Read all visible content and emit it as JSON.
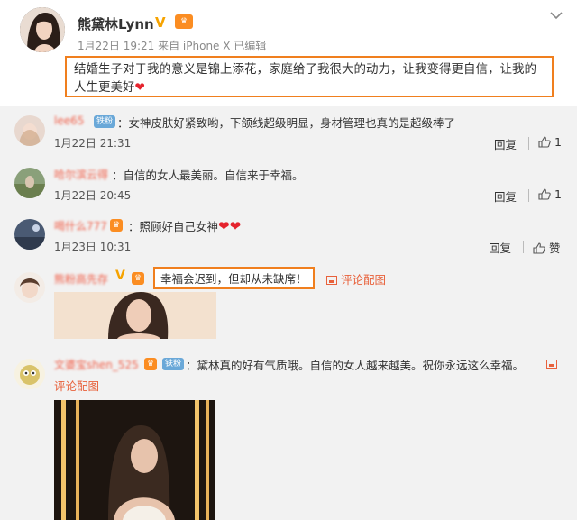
{
  "post": {
    "author": "熊黛林Lynn",
    "verified_badge": "V",
    "meta": "1月22日 19:21 来自 iPhone X   已编辑",
    "text": "结婚生子对于我的意义是锦上添花，家庭给了我很大的动力，让我变得更自信，让我的人生更美好",
    "heart": "❤"
  },
  "comments": [
    {
      "username": "lee65",
      "badge": "铁粉",
      "text": "：女神皮肤好紧致哟，下颌线超级明显，身材管理也真的是超级棒了",
      "time": "1月22日 21:31",
      "reply": "回复",
      "likes": "1"
    },
    {
      "username": "哈尔滨云得",
      "text": "：自信的女人最美丽。自信来于幸福。",
      "time": "1月22日 20:45",
      "reply": "回复",
      "likes": "1"
    },
    {
      "username": "喝什么777",
      "text": "：照顾好自己女神",
      "hearts": "❤❤",
      "time": "1月23日 10:31",
      "reply": "回复",
      "likes": "赞"
    },
    {
      "username": "熊粉高先存",
      "verified_badge": "V",
      "text": "幸福会迟到，但却从未缺席！",
      "pic_link": "评论配图"
    },
    {
      "username": "文婆宝shen_525",
      "badge": "铁粉",
      "text": "：黛林真的好有气质哦。自信的女人越来越美。祝你永远这么幸福。",
      "pic_link": "评论配图"
    }
  ],
  "colors": {
    "highlight_border": "#f07f1e",
    "username": "#f0604a",
    "link": "#e8613b",
    "badge_blue": "#6aa8d8",
    "badge_orange": "#fb8d22",
    "verified": "#f6a300"
  }
}
